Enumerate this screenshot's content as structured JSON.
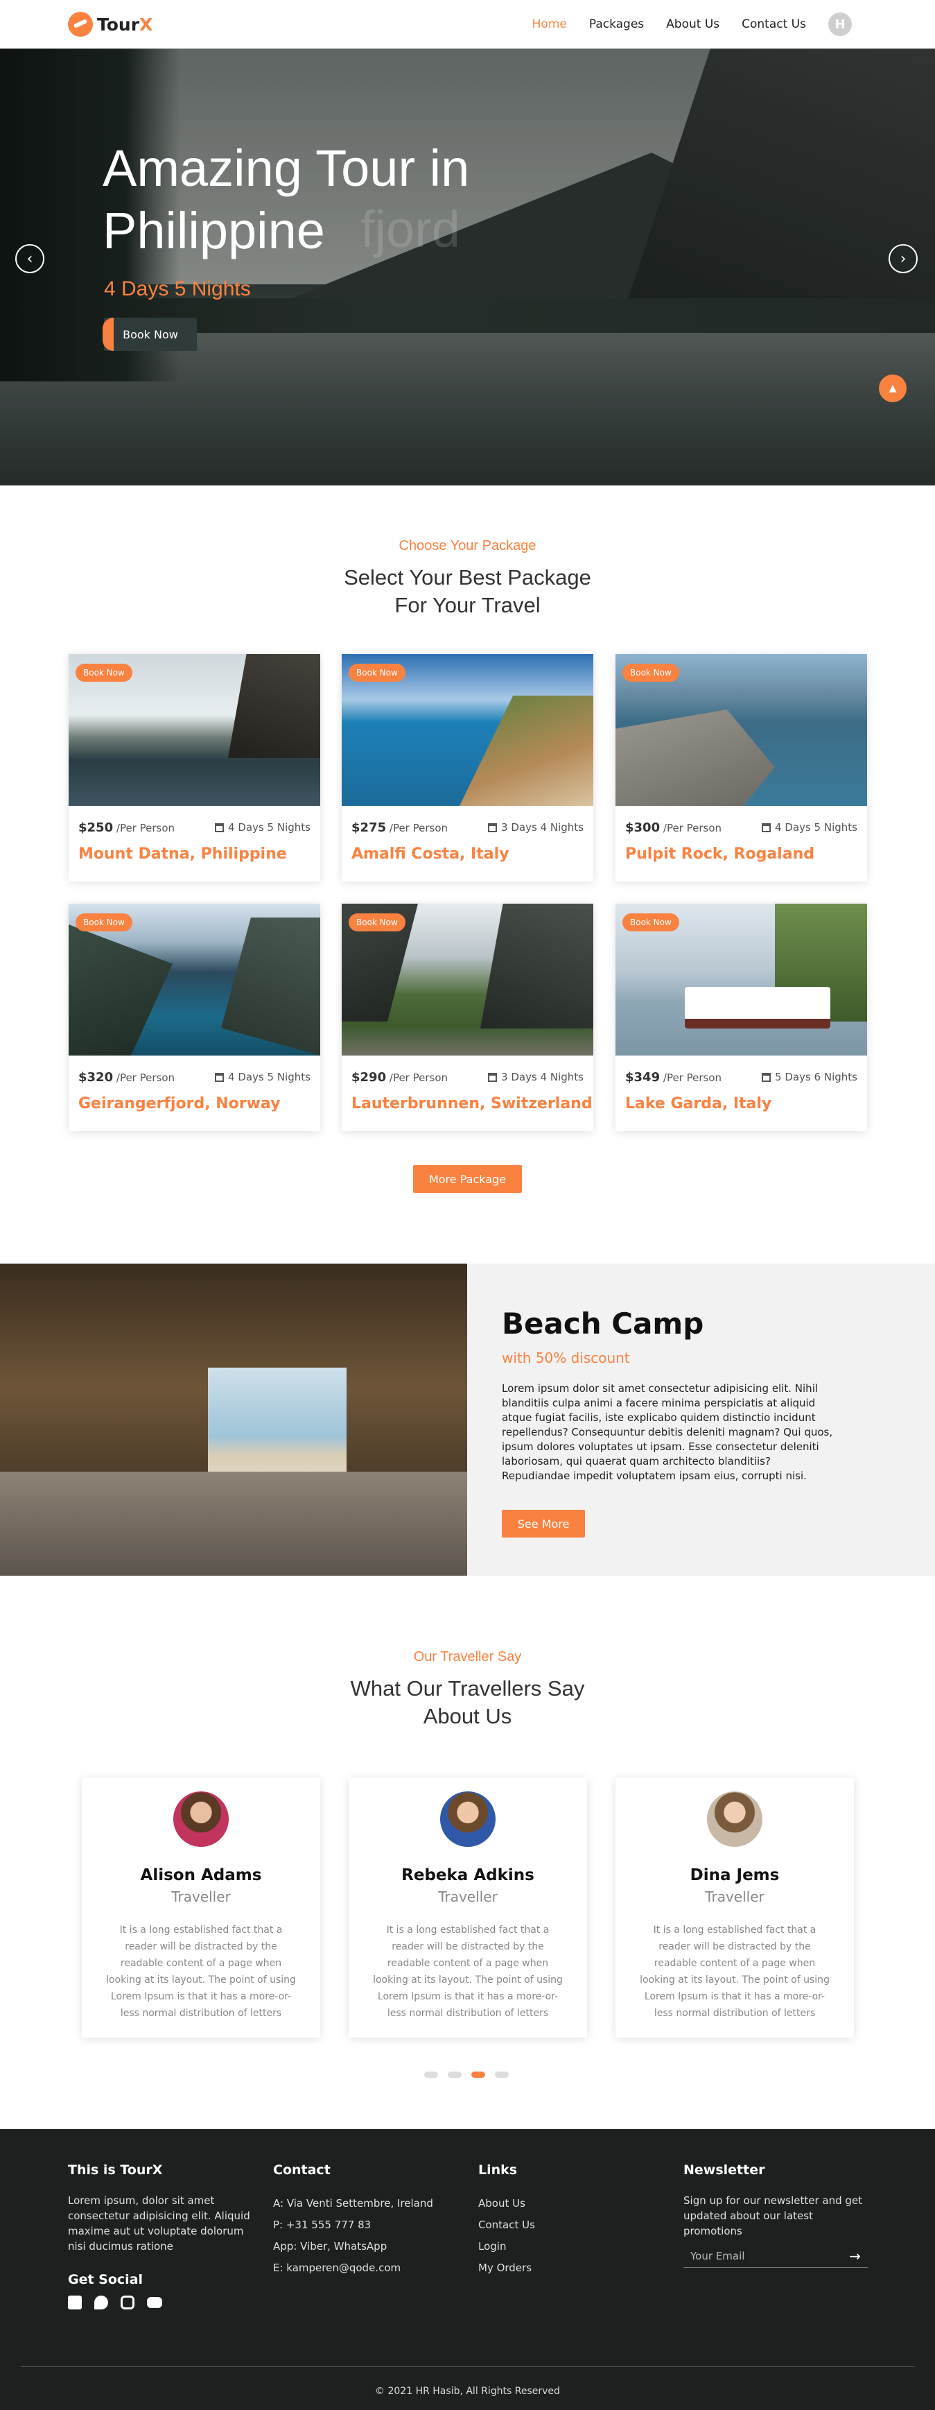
{
  "nav": {
    "brand_part1": "Tour",
    "brand_part2": "X",
    "items": [
      "Home",
      "Packages",
      "About Us",
      "Contact Us"
    ],
    "avatar_letter": "H",
    "accent": "#fa8241"
  },
  "hero": {
    "title": "Amazing Tour in Philippine",
    "ghost": "fjord",
    "subtitle": "4 Days 5 Nights",
    "button": "Book Now"
  },
  "packages": {
    "kicker": "Choose Your Package",
    "title_line1": "Select Your Best Package",
    "title_line2": "For Your Travel",
    "badge": "Book Now",
    "per": "/Per Person",
    "items": [
      {
        "price": "$250",
        "days": "4 Days 5 Nights",
        "name": "Mount Datna, Philippine"
      },
      {
        "price": "$275",
        "days": "3 Days 4 Nights",
        "name": "Amalfi Costa, Italy"
      },
      {
        "price": "$300",
        "days": "4 Days 5 Nights",
        "name": "Pulpit Rock, Rogaland"
      },
      {
        "price": "$320",
        "days": "4 Days 5 Nights",
        "name": "Geirangerfjord, Norway"
      },
      {
        "price": "$290",
        "days": "3 Days 4 Nights",
        "name": "Lauterbrunnen, Switzerland"
      },
      {
        "price": "$349",
        "days": "5 Days 6 Nights",
        "name": "Lake Garda, Italy"
      }
    ],
    "more_button": "More Package"
  },
  "camp": {
    "title": "Beach Camp",
    "discount": "with 50% discount",
    "text": "Lorem ipsum dolor sit amet consectetur adipisicing elit. Nihil blanditiis culpa animi a facere minima perspiciatis at aliquid atque fugiat facilis, iste explicabo quidem distinctio incidunt repellendus? Consequuntur debitis deleniti magnam? Qui quos, ipsum dolores voluptates ut ipsam. Esse consectetur deleniti laboriosam, qui quaerat quam architecto blanditiis? Repudiandae impedit voluptatem ipsam eius, corrupti nisi.",
    "button": "See More"
  },
  "testimonials": {
    "kicker": "Our Traveller Say",
    "title_line1": "What Our Travellers Say",
    "title_line2": "About Us",
    "items": [
      {
        "name": "Alison Adams",
        "role": "Traveller",
        "text": "It is a long established fact that a reader will be distracted by the readable content of a page when looking at its layout. The point of using Lorem Ipsum is that it has a more-or-less normal distribution of letters"
      },
      {
        "name": "Rebeka Adkins",
        "role": "Traveller",
        "text": "It is a long established fact that a reader will be distracted by the readable content of a page when looking at its layout. The point of using Lorem Ipsum is that it has a more-or-less normal distribution of letters"
      },
      {
        "name": "Dina Jems",
        "role": "Traveller",
        "text": "It is a long established fact that a reader will be distracted by the readable content of a page when looking at its layout. The point of using Lorem Ipsum is that it has a more-or-less normal distribution of letters"
      }
    ],
    "active_dot": 3
  },
  "footer": {
    "about_title": "This is TourX",
    "about_text": "Lorem ipsum, dolor sit amet consectetur adipisicing elit. Aliquid maxime aut ut voluptate dolorum nisi ducimus ratione",
    "social_title": "Get Social",
    "contact_title": "Contact",
    "contact": [
      "A: Via Venti Settembre, Ireland",
      "P: +31 555 777 83",
      "App: Viber, WhatsApp",
      "E: kamperen@qode.com"
    ],
    "links_title": "Links",
    "links": [
      "About Us",
      "Contact Us",
      "Login",
      "My Orders"
    ],
    "newsletter_title": "Newsletter",
    "newsletter_text": "Sign up for our newsletter and get updated about our latest promotions",
    "email_placeholder": "Your Email",
    "copyright": "© 2021 HR Hasib, All Rights Reserved"
  }
}
